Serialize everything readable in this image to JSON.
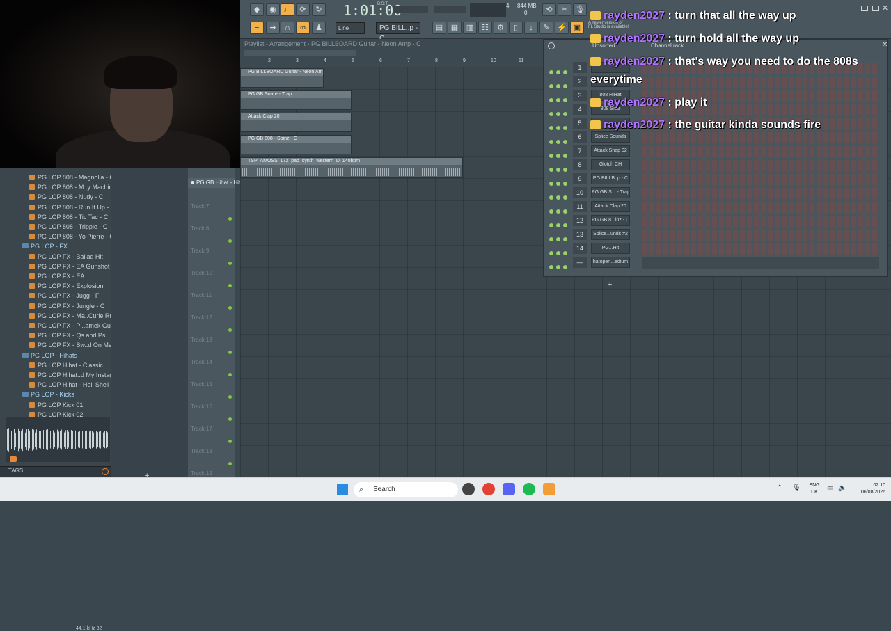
{
  "toolbar": {
    "time": "1:01:00",
    "bst": "B:S:T",
    "pattern": "PG BILL..p - C",
    "snap": "Line",
    "memory": "844 MB",
    "memory_value": "0",
    "cpu": "4"
  },
  "playlist": {
    "title": "Playlist - Arrangement › PG BILLBOARD Guitar - Neon Amp - C",
    "ruler": [
      "2",
      "3",
      "4",
      "5",
      "6",
      "7",
      "8",
      "9",
      "10",
      "11"
    ],
    "clips": [
      {
        "label": "PG BILLBOARD Guitar - Neon Amp - C"
      },
      {
        "label": "PG GB Snare - Trap"
      },
      {
        "label": "Attack Clap 20"
      },
      {
        "label": "PG GB 808 - Spinz - C"
      },
      {
        "label": "TSP_AMOSS_172_pad_synth_western_D_140bpm"
      }
    ],
    "selected_track": "PG GB Hihat - Hit",
    "tracks": [
      "Track 7",
      "Track 8",
      "Track 9",
      "Track 10",
      "Track 11",
      "Track 12",
      "Track 13",
      "Track 14",
      "Track 15",
      "Track 16",
      "Track 17",
      "Track 18",
      "Track 19"
    ]
  },
  "browser": {
    "items": [
      {
        "type": "item",
        "label": "PG LOP 808 - Magnolia - C"
      },
      {
        "type": "item",
        "label": "PG LOP 808 - M..y Machine - C"
      },
      {
        "type": "item",
        "label": "PG LOP 808 - Nudy - C"
      },
      {
        "type": "item",
        "label": "PG LOP 808 - Run It Up - C"
      },
      {
        "type": "item",
        "label": "PG LOP 808 - Tic Tac - C"
      },
      {
        "type": "item",
        "label": "PG LOP 808 - Trippie - C"
      },
      {
        "type": "item",
        "label": "PG LOP 808 - Yo Pierre - C"
      },
      {
        "type": "folder",
        "label": "PG LOP - FX"
      },
      {
        "type": "item",
        "label": "PG LOP FX - Ballad Hit"
      },
      {
        "type": "item",
        "label": "PG LOP FX - EA Gunshot"
      },
      {
        "type": "item",
        "label": "PG LOP FX - EA"
      },
      {
        "type": "item",
        "label": "PG LOP FX - Explosion"
      },
      {
        "type": "item",
        "label": "PG LOP FX - Jugg - F"
      },
      {
        "type": "item",
        "label": "PG LOP FX - Jungle - C"
      },
      {
        "type": "item",
        "label": "PG LOP FX - Ma..Curie Rumble"
      },
      {
        "type": "item",
        "label": "PG LOP FX - Pl..amek Gunshot"
      },
      {
        "type": "item",
        "label": "PG LOP FX - Qs and Ps"
      },
      {
        "type": "item",
        "label": "PG LOP FX - Sw..d On Me Lazer"
      },
      {
        "type": "folder",
        "label": "PG LOP - Hihats"
      },
      {
        "type": "item",
        "label": "PG LOP Hihat - Classic"
      },
      {
        "type": "item",
        "label": "PG LOP Hihat..d My Instagram"
      },
      {
        "type": "item",
        "label": "PG LOP Hihat - Hell Shell"
      },
      {
        "type": "folder",
        "label": "PG LOP - Kicks"
      },
      {
        "type": "item",
        "label": "PG LOP Kick 01"
      },
      {
        "type": "item",
        "label": "PG LOP Kick 02"
      }
    ],
    "tags": "TAGS",
    "sample_rate": "44.1 kHz 32"
  },
  "channel_rack": {
    "title": "Channel rack",
    "filter": "Unsorted",
    "channels": [
      {
        "num": "1",
        "name": ""
      },
      {
        "num": "2",
        "name": ""
      },
      {
        "num": "3",
        "name": "808 HiHat"
      },
      {
        "num": "4",
        "name": "808 Snar"
      },
      {
        "num": "5",
        "name": ""
      },
      {
        "num": "6",
        "name": "Splice Sounds"
      },
      {
        "num": "7",
        "name": "Attack Snap 02"
      },
      {
        "num": "8",
        "name": "Glotch CH"
      },
      {
        "num": "9",
        "name": "PG BILLB..p - C"
      },
      {
        "num": "10",
        "name": "PG GB S... - Trap"
      },
      {
        "num": "11",
        "name": "Attack Clap 20"
      },
      {
        "num": "12",
        "name": "PG GB 8...inz - C"
      },
      {
        "num": "13",
        "name": "Splice...unds #2"
      },
      {
        "num": "14",
        "name": "PG...Hit"
      },
      {
        "num": "—",
        "name": "hatopen...edium"
      }
    ],
    "add_label": "+"
  },
  "update_notice": {
    "line1": "A newer version of",
    "line2": "FL Studio is available!"
  },
  "chat": [
    {
      "user": "rayden2027",
      "text": ": turn that all the way up"
    },
    {
      "user": "rayden2027",
      "text": ": turn hold all the way up"
    },
    {
      "user": "rayden2027",
      "text": ": that's way you need to do the 808s everytime"
    },
    {
      "user": "rayden2027",
      "text": ": play it"
    },
    {
      "user": "rayden2027",
      "text": ": the guitar kinda sounds fire"
    }
  ],
  "taskbar": {
    "search": "Search",
    "lang_line1": "ENG",
    "lang_line2": "UK",
    "time": "02:10",
    "date": "06/08/2026"
  },
  "colors": {
    "accent": "#f0b04b",
    "chat_user": "#b173ff",
    "clip": "#566269"
  }
}
